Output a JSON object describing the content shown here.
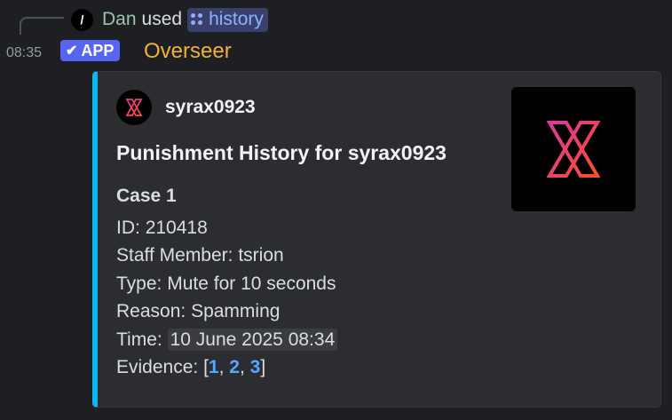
{
  "reply": {
    "command_glyph": "/",
    "user": "Dan",
    "verb": "used",
    "command": "history",
    "icon": "slash-command-icon"
  },
  "message": {
    "time": "08:35",
    "app_tag": "APP",
    "author": "Overseer",
    "author_color": "#f0b232"
  },
  "embed": {
    "accent_color": "#0fb6ef",
    "author_name": "syrax0923",
    "title": "Punishment History for syrax0923",
    "case_title": "Case 1",
    "id_label": "ID:",
    "id_value": "210418",
    "staff_label": "Staff Member:",
    "staff_value": "tsrion",
    "type_label": "Type:",
    "type_value": "Mute for 10 seconds",
    "reason_label": "Reason:",
    "reason_value": "Spamming",
    "time_label": "Time:",
    "time_value": "10 June 2025 08:34",
    "evidence_label": "Evidence:",
    "evidence_open": "[",
    "evidence_close": "]",
    "evidence_sep": ",",
    "evidence_links": [
      "1",
      "2",
      "3"
    ]
  }
}
